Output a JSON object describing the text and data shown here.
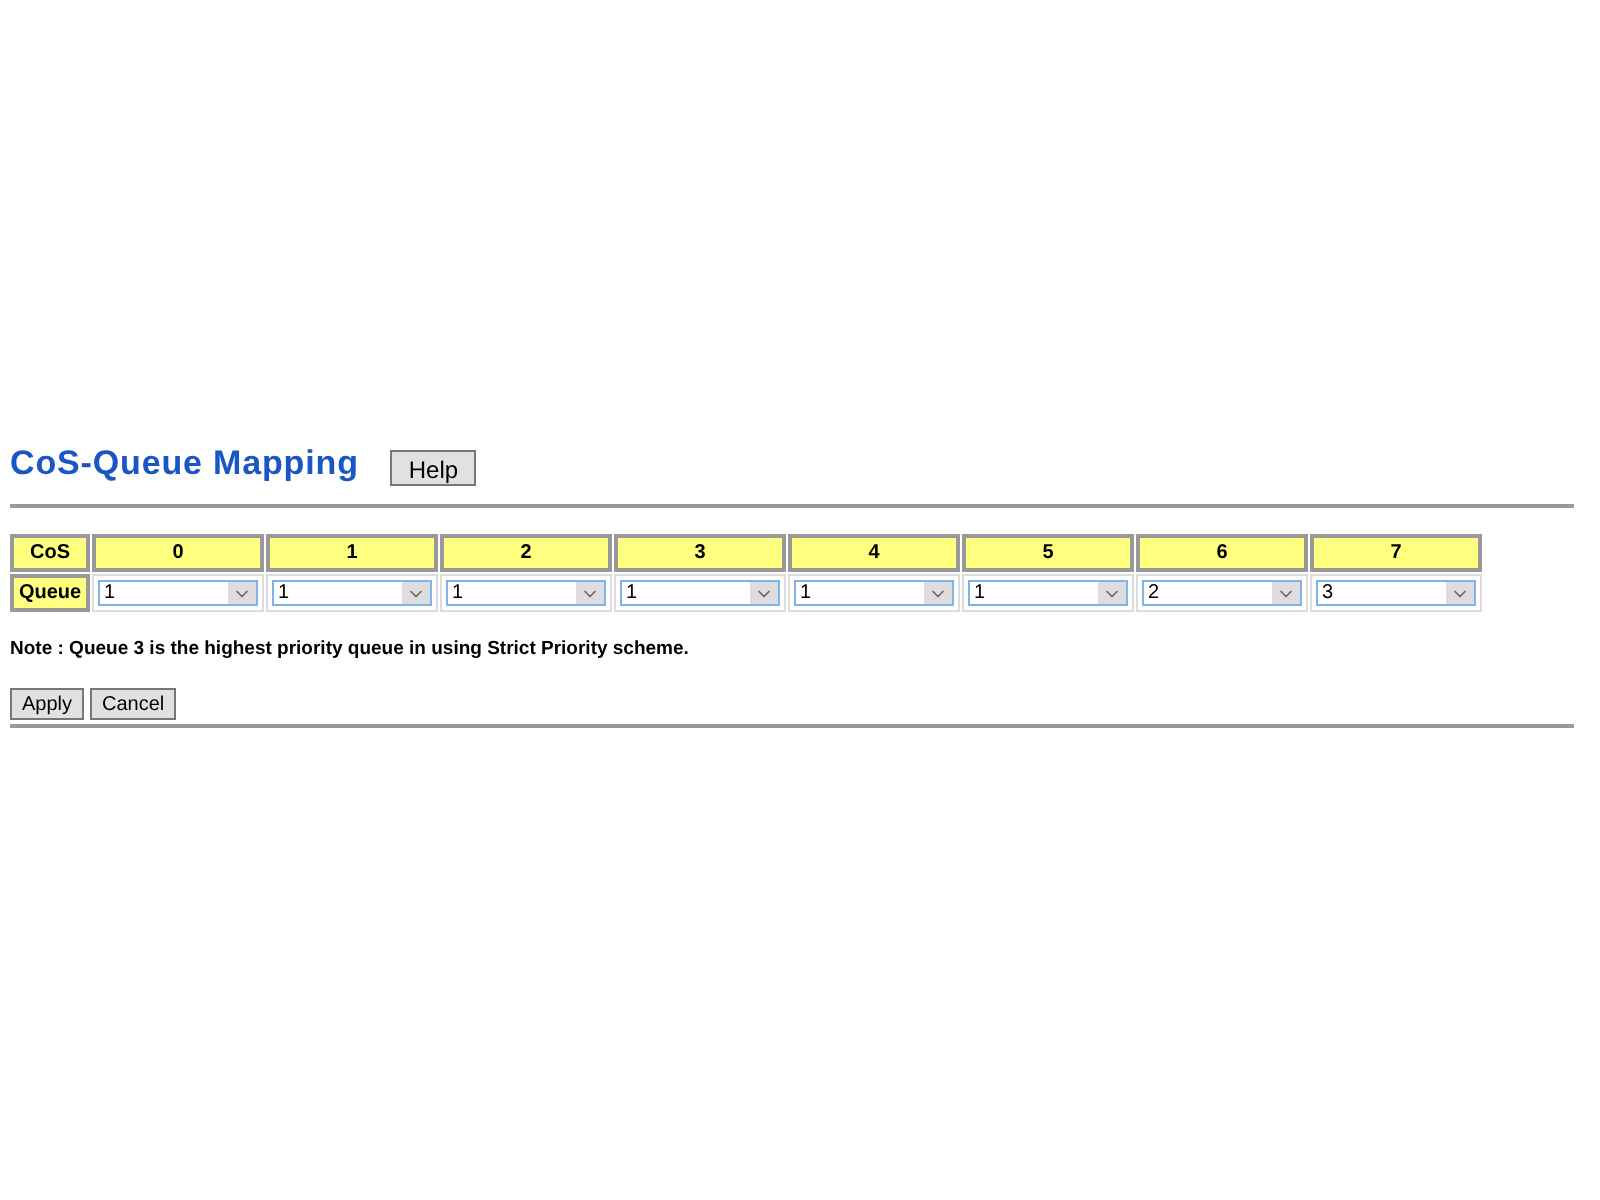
{
  "title": "CoS-Queue Mapping",
  "help_button": "Help",
  "table": {
    "row_headers": [
      "CoS",
      "Queue"
    ],
    "columns": [
      {
        "cos": "0",
        "queue": "1"
      },
      {
        "cos": "1",
        "queue": "1"
      },
      {
        "cos": "2",
        "queue": "1"
      },
      {
        "cos": "3",
        "queue": "1"
      },
      {
        "cos": "4",
        "queue": "1"
      },
      {
        "cos": "5",
        "queue": "1"
      },
      {
        "cos": "6",
        "queue": "2"
      },
      {
        "cos": "7",
        "queue": "3"
      }
    ]
  },
  "note": "Note : Queue 3 is the highest priority queue in using Strict Priority scheme.",
  "buttons": [
    "Apply",
    "Cancel"
  ]
}
